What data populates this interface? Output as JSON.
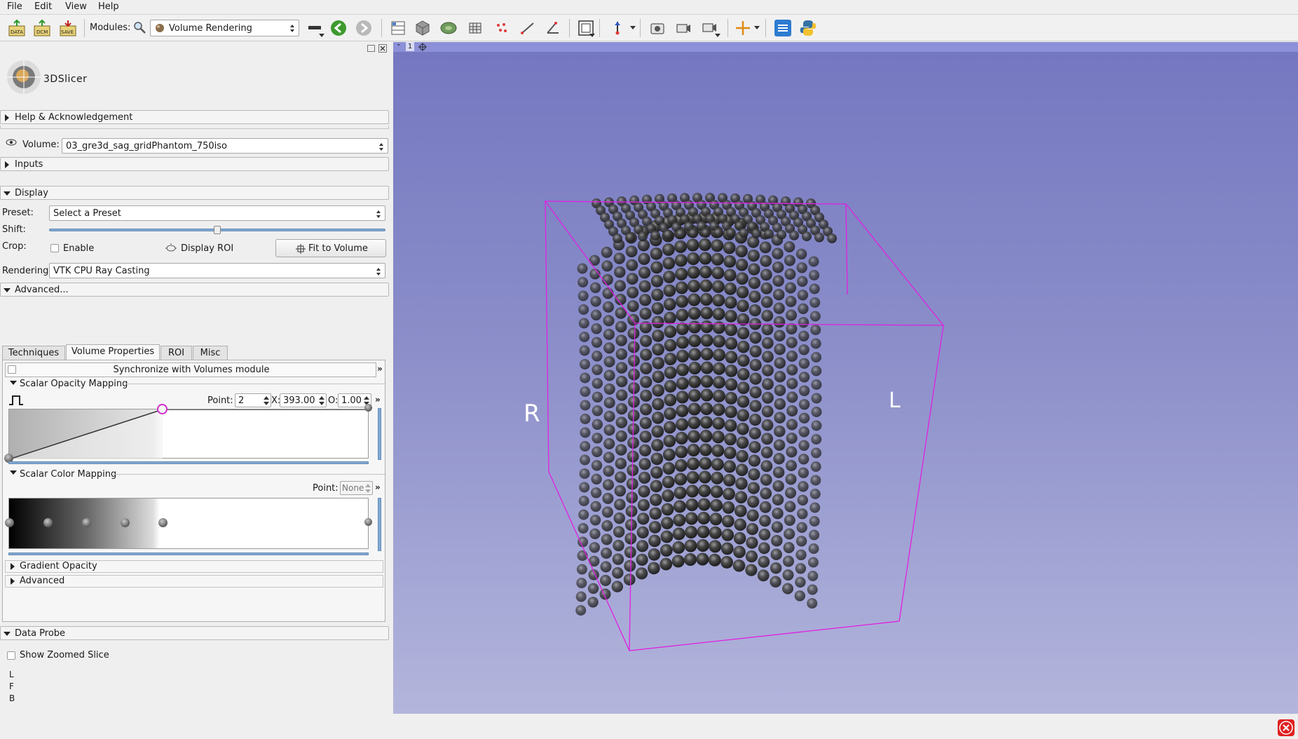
{
  "menu": [
    "File",
    "Edit",
    "View",
    "Help"
  ],
  "toolbar": {
    "modules_label": "Modules:",
    "current_module": "Volume Rendering",
    "data_icon_text": "DATA",
    "dcm_icon_text": "DCM",
    "save_icon_text": "SAVE"
  },
  "logo": {
    "prefix": "3D",
    "name": "Slicer"
  },
  "sections": {
    "help": "Help & Acknowledgement",
    "inputs": "Inputs",
    "display": "Display",
    "advanced": "Advanced...",
    "data_probe": "Data Probe"
  },
  "volume": {
    "label": "Volume:",
    "value": "03_gre3d_sag_gridPhantom_750iso"
  },
  "display": {
    "preset_label": "Preset:",
    "preset_value": "Select a Preset",
    "shift_label": "Shift:",
    "shift_level": 0.5,
    "crop_label": "Crop:",
    "enable_label": "Enable",
    "display_roi_label": "Display ROI",
    "fit_button": "Fit to Volume",
    "rendering_label": "Rendering:",
    "rendering_value": "VTK CPU Ray Casting"
  },
  "tabs": [
    "Techniques",
    "Volume Properties",
    "ROI",
    "Misc"
  ],
  "active_tab": "Volume Properties",
  "sync_button": "Synchronize with Volumes module",
  "opacity": {
    "title": "Scalar Opacity Mapping",
    "point_label": "Point:",
    "point_value": "2",
    "x_label": "X:",
    "x_value": "393.00",
    "o_label": "O:",
    "o_value": "1.00"
  },
  "color": {
    "title": "Scalar Color Mapping",
    "point_label": "Point:",
    "point_placeholder": "None"
  },
  "gradient_opacity": "Gradient Opacity",
  "advanced_sub": "Advanced",
  "probe": {
    "show_zoomed": "Show Zoomed Slice",
    "lines": [
      "L",
      "F",
      "B"
    ]
  },
  "view": {
    "tab_number": "1",
    "orientation_left": "R",
    "orientation_right": "L"
  },
  "colors": {
    "roi_box": "#e020e0",
    "view_bar": "#8c90d6",
    "opacity_point": "#d22ad2"
  }
}
